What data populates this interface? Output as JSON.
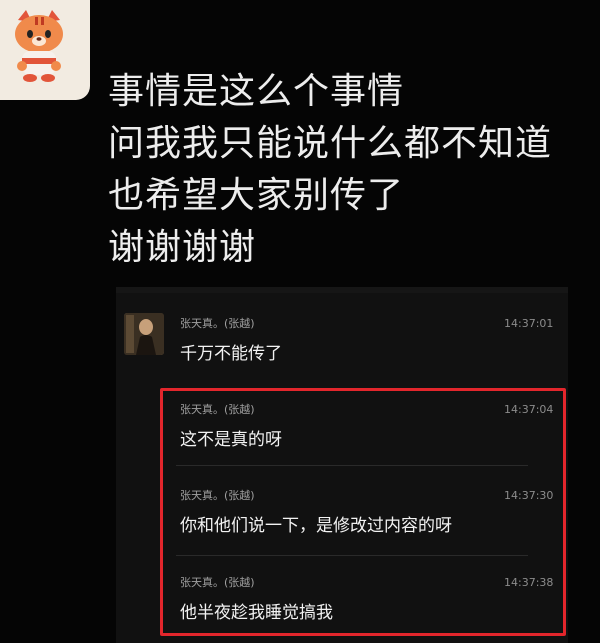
{
  "post": {
    "lines": [
      "事情是这么个事情",
      "问我我只能说什么都不知道",
      "也希望大家别传了",
      "谢谢谢谢"
    ]
  },
  "chat": {
    "messages": [
      {
        "sender": "张天真。(张越)",
        "time": "14:37:01",
        "text": "千万不能传了"
      },
      {
        "sender": "张天真。(张越)",
        "time": "14:37:04",
        "text": "这不是真的呀"
      },
      {
        "sender": "张天真。(张越)",
        "time": "14:37:30",
        "text": "你和他们说一下，是修改过内容的呀"
      },
      {
        "sender": "张天真。(张越)",
        "time": "14:37:38",
        "text": "他半夜趁我睡觉搞我"
      }
    ]
  },
  "colors": {
    "background": "#050505",
    "highlight": "#e3262c",
    "avatar_bg": "#f2ebe1"
  },
  "icons": {
    "top_avatar": "cartoon-tiger-avatar-icon"
  }
}
